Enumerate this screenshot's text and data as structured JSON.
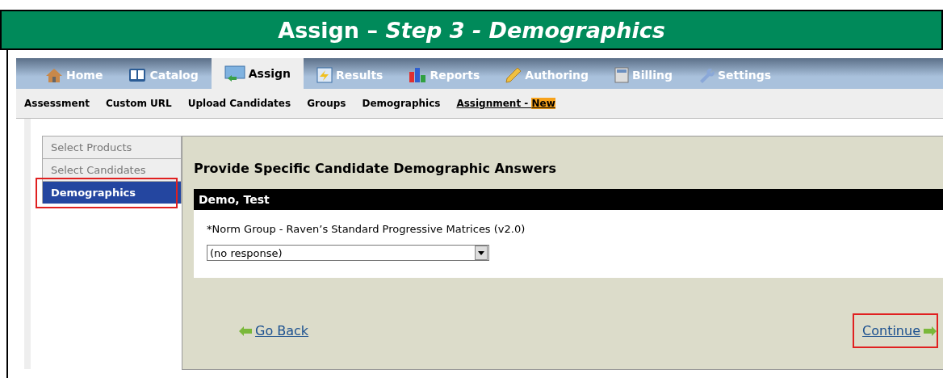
{
  "banner": {
    "title": "Assign – *Step 3 - Demographics*"
  },
  "nav_tabs": [
    {
      "label": "Home",
      "kind": "house",
      "selected": false
    },
    {
      "label": "Catalog",
      "kind": "book",
      "selected": false
    },
    {
      "label": "Assign",
      "kind": "assign",
      "selected": true
    },
    {
      "label": "Results",
      "kind": "results",
      "selected": false
    },
    {
      "label": "Reports",
      "kind": "chart",
      "selected": false
    },
    {
      "label": "Authoring",
      "kind": "pencil",
      "selected": false
    },
    {
      "label": "Billing",
      "kind": "calculator",
      "selected": false
    },
    {
      "label": "Settings",
      "kind": "wrench",
      "selected": false
    }
  ],
  "sub_nav": [
    {
      "label": "Assessment",
      "selected": false
    },
    {
      "label": "Custom URL",
      "selected": false
    },
    {
      "label": "Upload Candidates",
      "selected": false
    },
    {
      "label": "Groups",
      "selected": false
    },
    {
      "label": "Demographics",
      "selected": false
    },
    {
      "label": "Assignment - ",
      "badge": "New",
      "selected": true
    }
  ],
  "steps": [
    {
      "label": "Select Products",
      "selected": false,
      "highlighted": false
    },
    {
      "label": "Select Candidates",
      "selected": false,
      "highlighted": false
    },
    {
      "label": "Demographics",
      "selected": true,
      "highlighted": true
    }
  ],
  "panel": {
    "heading": "Provide Specific Candidate Demographic Answers",
    "candidate": "Demo, Test",
    "question": "*Norm Group - Raven’s Standard Progressive Matrices (v2.0)",
    "answer": "(no response)"
  },
  "actions": {
    "back": "Go Back",
    "continue": "Continue",
    "continue_highlighted": true
  }
}
